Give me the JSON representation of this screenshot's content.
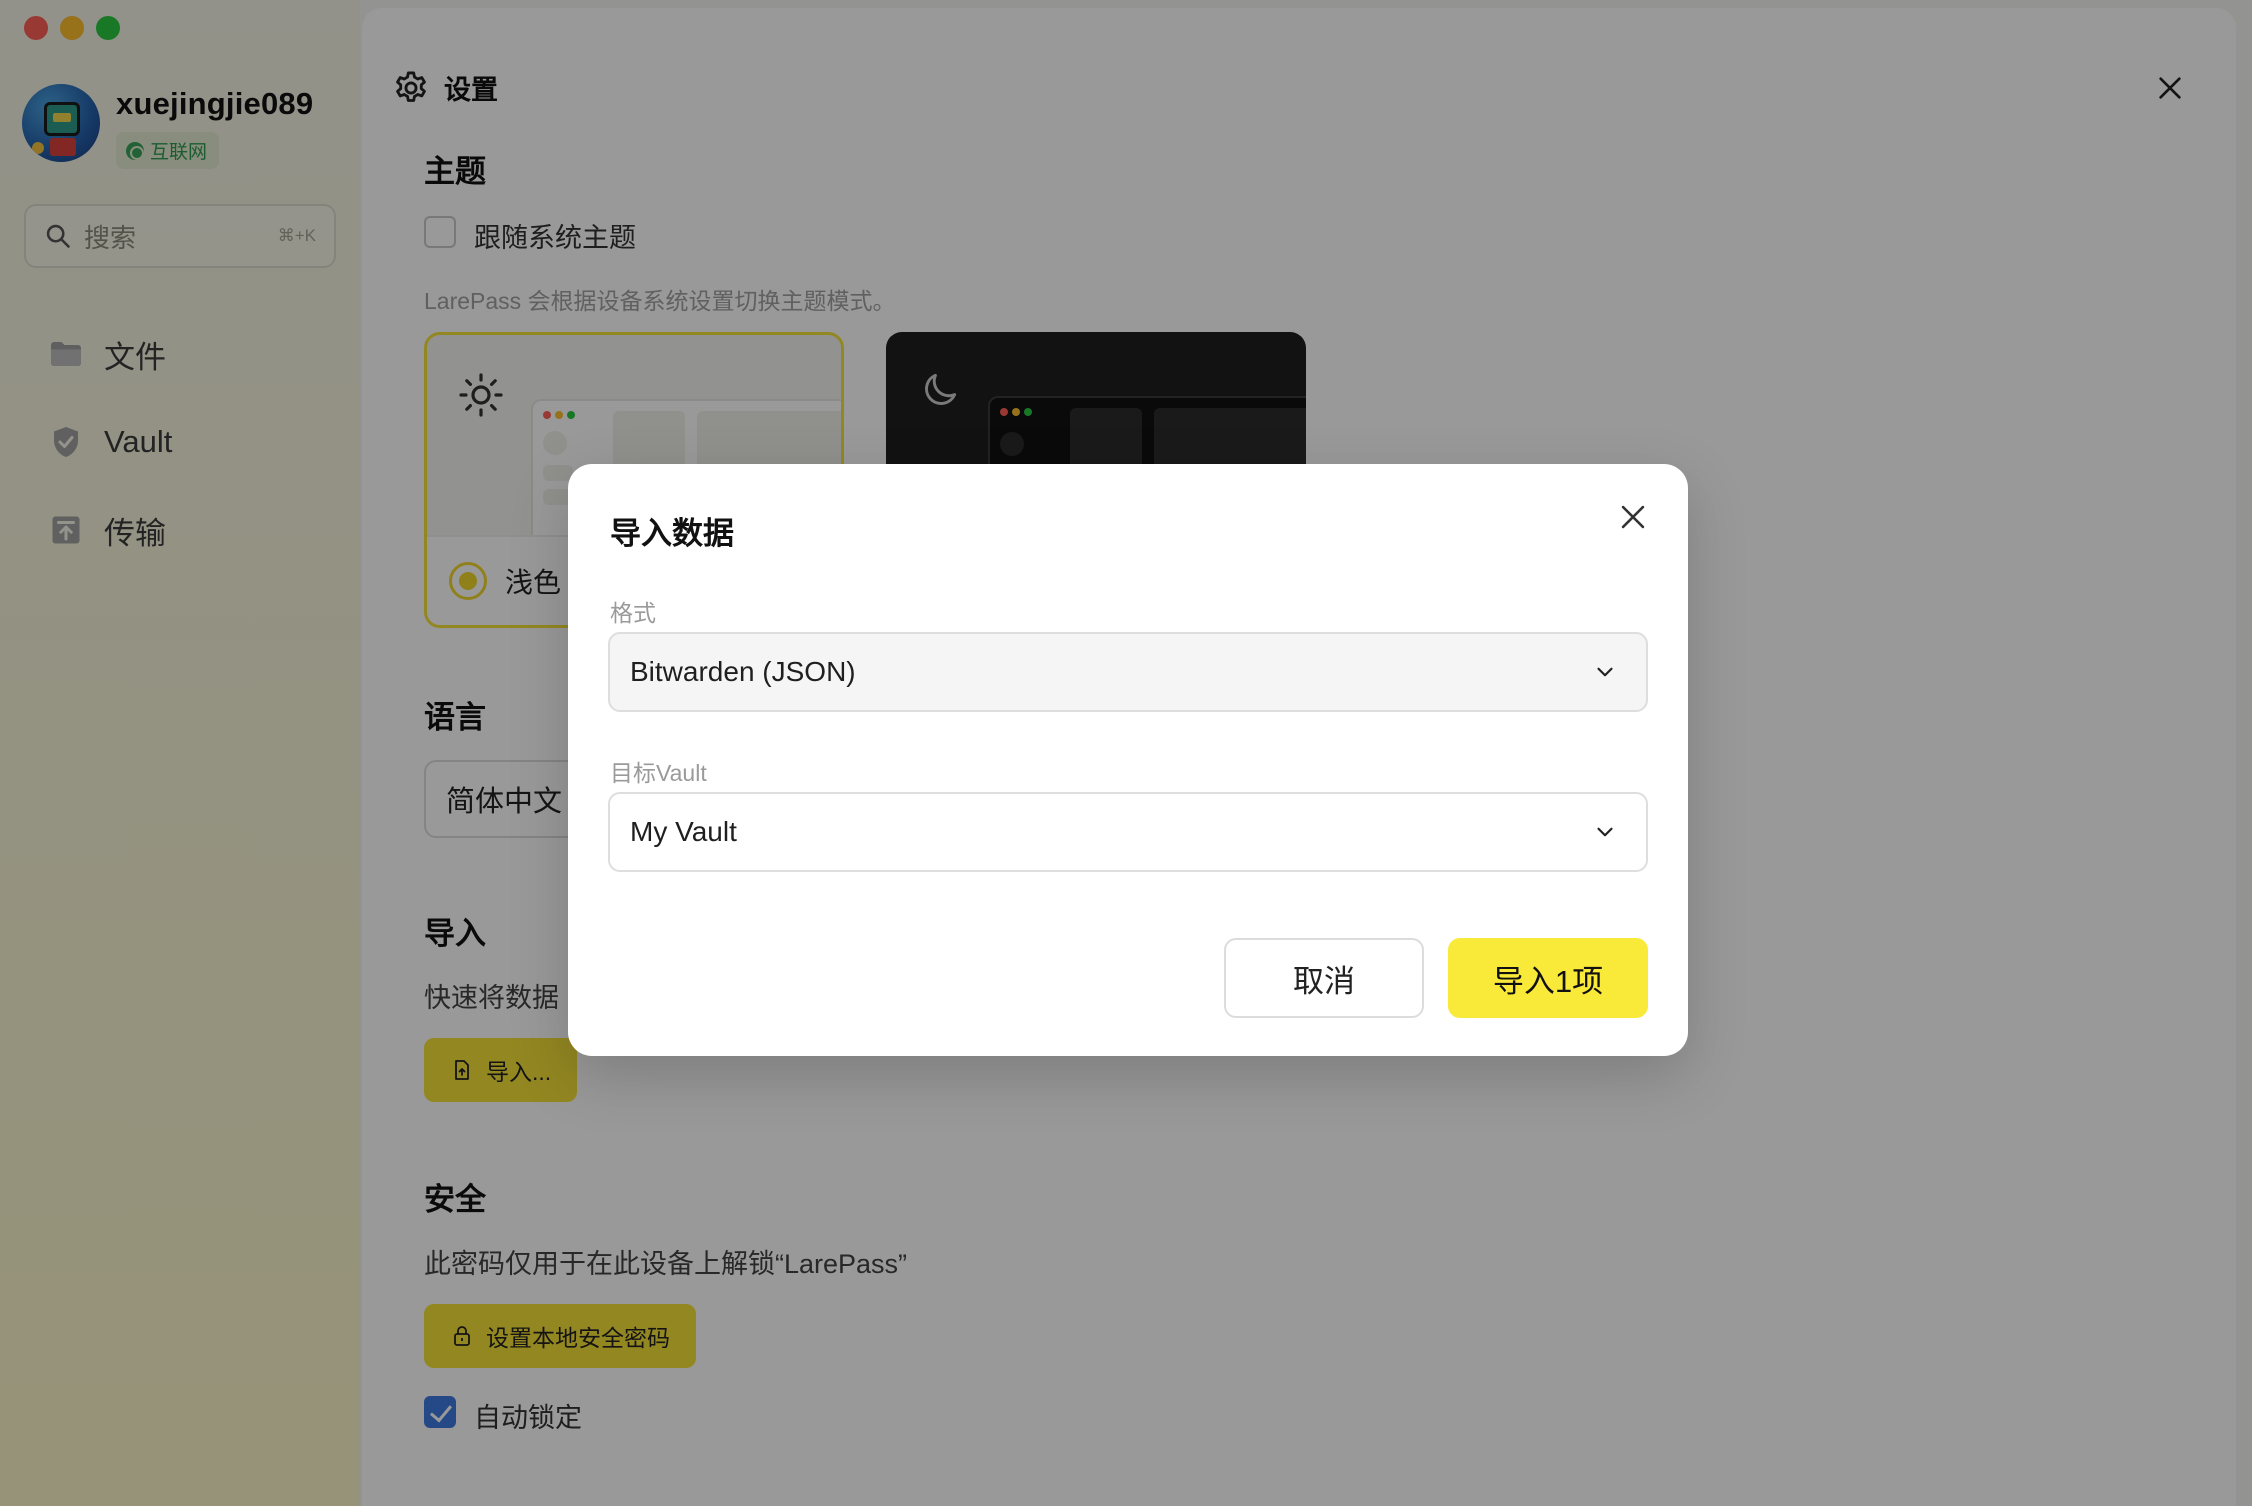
{
  "user": {
    "name": "xuejingjie089",
    "network": "互联网"
  },
  "search": {
    "placeholder": "搜索",
    "shortcut": "⌘+K"
  },
  "nav": [
    {
      "label": "文件",
      "icon": "folder-icon"
    },
    {
      "label": "Vault",
      "icon": "shield-icon"
    },
    {
      "label": "传输",
      "icon": "transfer-icon"
    }
  ],
  "settings": {
    "title": "设置",
    "theme": {
      "title": "主题",
      "follow_system": "跟随系统主题",
      "follow_system_checked": false,
      "hint": "LarePass 会根据设备系统设置切换主题模式。",
      "light_label": "浅色",
      "selected": "light"
    },
    "language": {
      "title": "语言",
      "value": "简体中文"
    },
    "import": {
      "title": "导入",
      "desc": "快速将数据",
      "button": "导入..."
    },
    "security": {
      "title": "安全",
      "desc": "此密码仅用于在此设备上解锁“LarePass”",
      "button": "设置本地安全密码",
      "auto_lock": "自动锁定",
      "auto_lock_checked": true
    }
  },
  "dialog": {
    "title": "导入数据",
    "format_label": "格式",
    "format_value": "Bitwarden (JSON)",
    "vault_label": "目标Vault",
    "vault_value": "My Vault",
    "cancel": "取消",
    "confirm": "导入1项"
  },
  "colors": {
    "accent": "#f9e939",
    "checkbox": "#3e7ae0",
    "network": "#2f9a52"
  }
}
